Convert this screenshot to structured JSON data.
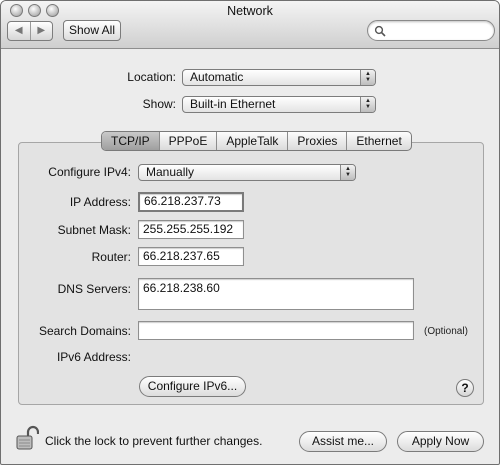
{
  "window": {
    "title": "Network",
    "show_all_label": "Show All",
    "back_arrow": "◀",
    "forward_arrow": "▶",
    "search_placeholder": ""
  },
  "location": {
    "label": "Location:",
    "value": "Automatic"
  },
  "show": {
    "label": "Show:",
    "value": "Built-in Ethernet"
  },
  "tabs": [
    {
      "label": "TCP/IP",
      "active": true
    },
    {
      "label": "PPPoE",
      "active": false
    },
    {
      "label": "AppleTalk",
      "active": false
    },
    {
      "label": "Proxies",
      "active": false
    },
    {
      "label": "Ethernet",
      "active": false
    }
  ],
  "tcpip": {
    "configure_ipv4": {
      "label": "Configure IPv4:",
      "value": "Manually"
    },
    "ip_address": {
      "label": "IP Address:",
      "value": "66.218.237.73"
    },
    "subnet_mask": {
      "label": "Subnet Mask:",
      "value": "255.255.255.192"
    },
    "router": {
      "label": "Router:",
      "value": "66.218.237.65"
    },
    "dns_servers": {
      "label": "DNS Servers:",
      "value": "66.218.238.60"
    },
    "search_domains": {
      "label": "Search Domains:",
      "value": "",
      "hint": "(Optional)"
    },
    "ipv6_address": {
      "label": "IPv6 Address:",
      "value": ""
    },
    "configure_ipv6_label": "Configure IPv6...",
    "help_label": "?"
  },
  "footer": {
    "lock_text": "Click the lock to prevent further changes.",
    "assist_label": "Assist me...",
    "apply_label": "Apply Now"
  }
}
